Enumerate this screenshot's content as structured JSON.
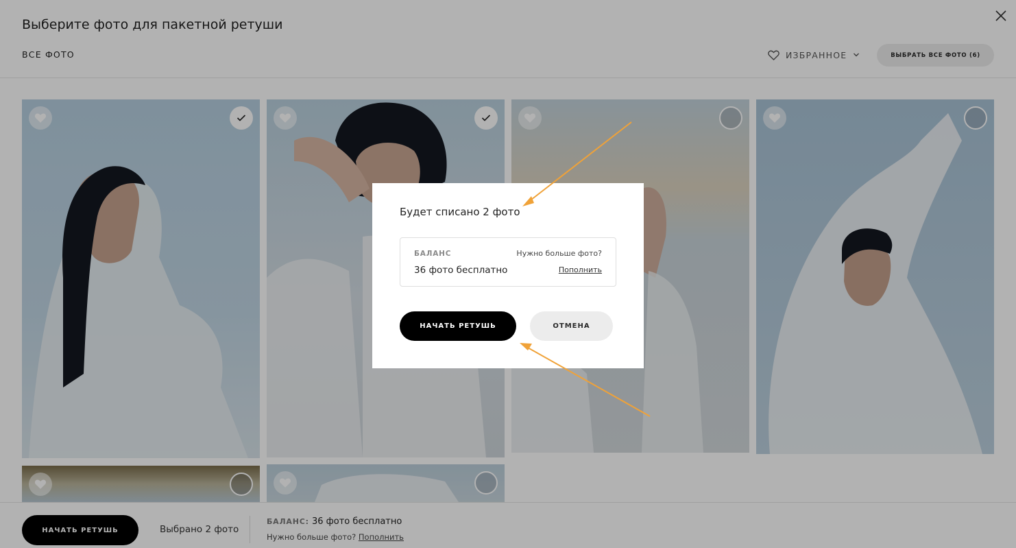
{
  "header": {
    "title": "Выберите фото для пакетной ретуши",
    "tab_all": "ВСЕ ФОТО",
    "favorites_label": "ИЗБРАННОЕ",
    "select_all_label": "ВЫБРАТЬ ВСЕ ФОТО (6)"
  },
  "photos": [
    {
      "selected": true
    },
    {
      "selected": true
    },
    {
      "selected": false
    },
    {
      "selected": false
    },
    {
      "selected": false
    },
    {
      "selected": false
    }
  ],
  "bottom_bar": {
    "start_label": "НАЧАТЬ РЕТУШЬ",
    "selected_prefix": "Выбрано",
    "selected_count": "2 фото",
    "balance_label": "БАЛАНС:",
    "balance_value": "36 фото бесплатно",
    "need_more": "Нужно больше фото?",
    "topup_link": "Пополнить"
  },
  "modal": {
    "heading": "Будет списано 2 фото",
    "balance_label": "БАЛАНС",
    "balance_value": "36 фото бесплатно",
    "need_more": "Нужно больше фото?",
    "topup_link": "Пополнить",
    "start_label": "НАЧАТЬ РЕТУШЬ",
    "cancel_label": "ОТМЕНА"
  },
  "icons": {
    "close": "close-icon",
    "heart": "heart-icon",
    "chevron": "chevron-down-icon",
    "check": "check-icon"
  },
  "colors": {
    "primary_button": "#000000",
    "secondary_button": "#ececec",
    "annotation_arrow": "#f0a238"
  }
}
